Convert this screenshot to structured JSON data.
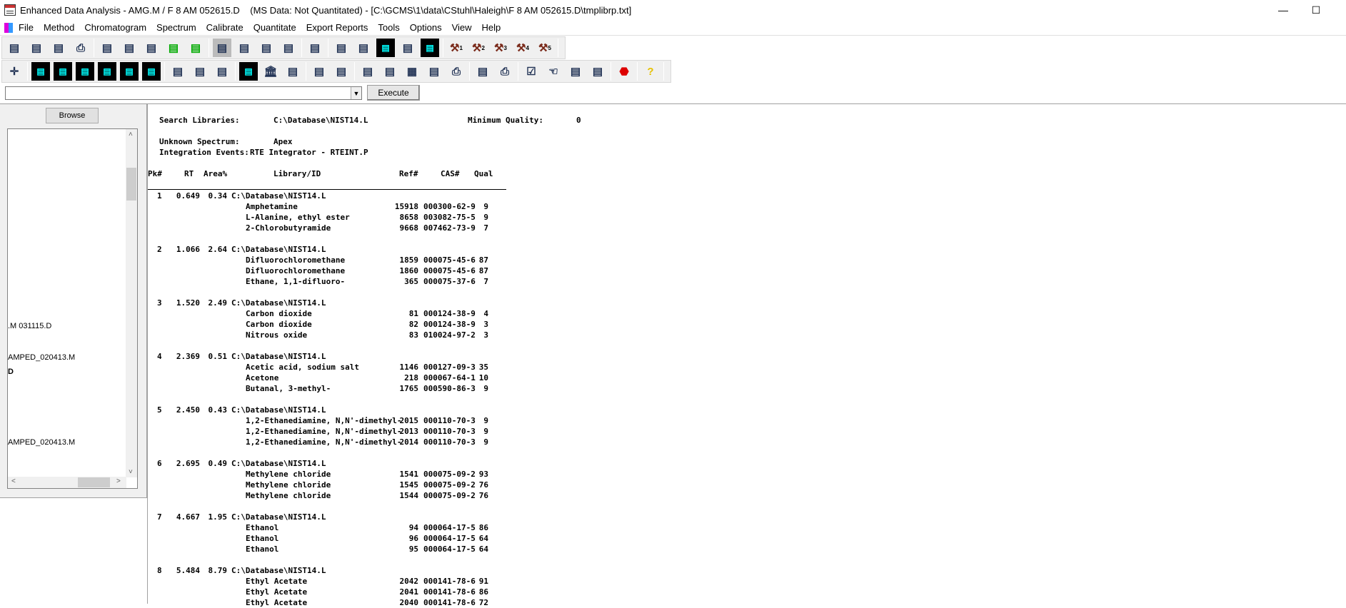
{
  "window": {
    "title": "Enhanced Data Analysis - AMG.M / F 8 AM 052615.D    (MS Data: Not Quantitated) - [C:\\GCMS\\1\\data\\CStuhl\\Haleigh\\F 8 AM 052615.D\\tmplibrp.txt]",
    "minimize": "—",
    "maximize": "☐"
  },
  "menu": [
    "File",
    "Method",
    "Chromatogram",
    "Spectrum",
    "Calibrate",
    "Quantitate",
    "Export Reports",
    "Tools",
    "Options",
    "View",
    "Help"
  ],
  "toolbar1": [
    [
      "open-data-icon",
      "load-data-icon",
      "snapshot-icon",
      "print-icon"
    ],
    [
      "load-method-icon",
      "save-method-icon",
      "run-method-icon",
      "sim-check-icon",
      "sim-edit-icon"
    ],
    [
      "layout-icon",
      "export-layout-icon",
      "color-grid-icon",
      "window-tile-icon"
    ],
    [
      "report-icon"
    ],
    [
      "id-card-icon",
      "edit-id-icon",
      "overlay-peaks-icon",
      "lock-peak-icon",
      "tic-icon"
    ],
    [
      "macro-1-icon",
      "macro-2-icon",
      "macro-3-icon",
      "macro-4-icon",
      "macro-5-icon"
    ]
  ],
  "toolbar1_macro_numbers": [
    "1",
    "2",
    "3",
    "4",
    "5"
  ],
  "toolbar2": [
    [
      "compass-icon"
    ],
    [
      "chromatogram-icon",
      "zoom-chromatogram-icon",
      "mass-spectrum-icon",
      "extract-ion-icon",
      "integrate-down-icon",
      "integrate-check-icon"
    ],
    [
      "peak-check-icon",
      "peak-icon",
      "xy-ratio-icon"
    ],
    [
      "bar-spectrum-icon",
      "library-icon",
      "library-search-icon"
    ],
    [
      "blank-plot-icon",
      "plot-check-icon"
    ],
    [
      "edit-calibration-icon",
      "update-calibration-icon",
      "calculator-icon",
      "quant-report-icon",
      "quant-print-icon"
    ],
    [
      "document-icon",
      "print-document-icon"
    ],
    [
      "ab-checkbox-icon",
      "hand-pointer-icon",
      "xyz-icon",
      "cursor-icon"
    ],
    [
      "stop-icon"
    ],
    [
      "help-icon"
    ]
  ],
  "command": {
    "value": "",
    "execute_label": "Execute"
  },
  "left_panel": {
    "browse_label": "Browse",
    "items": [
      ".M 031115.D",
      "AMPED_020413.M",
      "D",
      "AMPED_020413.M"
    ]
  },
  "report": {
    "search_libraries_label": "Search Libraries:",
    "search_libraries_value": "C:\\Database\\NIST14.L",
    "min_quality_label": "Minimum Quality:",
    "min_quality_value": "0",
    "unknown_spectrum_label": "Unknown Spectrum:",
    "unknown_spectrum_value": "Apex",
    "integration_events_label": "Integration Events:",
    "integration_events_value": "RTE Integrator - RTEINT.P",
    "columns": {
      "pk": "Pk#",
      "rt": "RT",
      "area": "Area%",
      "lib": "Library/ID",
      "ref": "Ref#",
      "cas": "CAS#",
      "qual": "Qual"
    },
    "peaks": [
      {
        "pk": "1",
        "rt": "0.649",
        "area": "0.34",
        "library": "C:\\Database\\NIST14.L",
        "hits": [
          {
            "name": "Amphetamine",
            "ref": "15918",
            "cas": "000300-62-9",
            "qual": "9"
          },
          {
            "name": "L-Alanine, ethyl ester",
            "ref": "8658",
            "cas": "003082-75-5",
            "qual": "9"
          },
          {
            "name": "2-Chlorobutyramide",
            "ref": "9668",
            "cas": "007462-73-9",
            "qual": "7"
          }
        ]
      },
      {
        "pk": "2",
        "rt": "1.066",
        "area": "2.64",
        "library": "C:\\Database\\NIST14.L",
        "hits": [
          {
            "name": "Difluorochloromethane",
            "ref": "1859",
            "cas": "000075-45-6",
            "qual": "87"
          },
          {
            "name": "Difluorochloromethane",
            "ref": "1860",
            "cas": "000075-45-6",
            "qual": "87"
          },
          {
            "name": "Ethane, 1,1-difluoro-",
            "ref": "365",
            "cas": "000075-37-6",
            "qual": "7"
          }
        ]
      },
      {
        "pk": "3",
        "rt": "1.520",
        "area": "2.49",
        "library": "C:\\Database\\NIST14.L",
        "hits": [
          {
            "name": "Carbon dioxide",
            "ref": "81",
            "cas": "000124-38-9",
            "qual": "4"
          },
          {
            "name": "Carbon dioxide",
            "ref": "82",
            "cas": "000124-38-9",
            "qual": "3"
          },
          {
            "name": "Nitrous oxide",
            "ref": "83",
            "cas": "010024-97-2",
            "qual": "3"
          }
        ]
      },
      {
        "pk": "4",
        "rt": "2.369",
        "area": "0.51",
        "library": "C:\\Database\\NIST14.L",
        "hits": [
          {
            "name": "Acetic acid, sodium salt",
            "ref": "1146",
            "cas": "000127-09-3",
            "qual": "35"
          },
          {
            "name": "Acetone",
            "ref": "218",
            "cas": "000067-64-1",
            "qual": "10"
          },
          {
            "name": "Butanal, 3-methyl-",
            "ref": "1765",
            "cas": "000590-86-3",
            "qual": "9"
          }
        ]
      },
      {
        "pk": "5",
        "rt": "2.450",
        "area": "0.43",
        "library": "C:\\Database\\NIST14.L",
        "hits": [
          {
            "name": "1,2-Ethanediamine, N,N'-dimethyl-",
            "ref": "2015",
            "cas": "000110-70-3",
            "qual": "9"
          },
          {
            "name": "1,2-Ethanediamine, N,N'-dimethyl-",
            "ref": "2013",
            "cas": "000110-70-3",
            "qual": "9"
          },
          {
            "name": "1,2-Ethanediamine, N,N'-dimethyl-",
            "ref": "2014",
            "cas": "000110-70-3",
            "qual": "9"
          }
        ]
      },
      {
        "pk": "6",
        "rt": "2.695",
        "area": "0.49",
        "library": "C:\\Database\\NIST14.L",
        "hits": [
          {
            "name": "Methylene chloride",
            "ref": "1541",
            "cas": "000075-09-2",
            "qual": "93"
          },
          {
            "name": "Methylene chloride",
            "ref": "1545",
            "cas": "000075-09-2",
            "qual": "76"
          },
          {
            "name": "Methylene chloride",
            "ref": "1544",
            "cas": "000075-09-2",
            "qual": "76"
          }
        ]
      },
      {
        "pk": "7",
        "rt": "4.667",
        "area": "1.95",
        "library": "C:\\Database\\NIST14.L",
        "hits": [
          {
            "name": "Ethanol",
            "ref": "94",
            "cas": "000064-17-5",
            "qual": "86"
          },
          {
            "name": "Ethanol",
            "ref": "96",
            "cas": "000064-17-5",
            "qual": "64"
          },
          {
            "name": "Ethanol",
            "ref": "95",
            "cas": "000064-17-5",
            "qual": "64"
          }
        ]
      },
      {
        "pk": "8",
        "rt": "5.484",
        "area": "8.79",
        "library": "C:\\Database\\NIST14.L",
        "hits": [
          {
            "name": "Ethyl Acetate",
            "ref": "2042",
            "cas": "000141-78-6",
            "qual": "91"
          },
          {
            "name": "Ethyl Acetate",
            "ref": "2041",
            "cas": "000141-78-6",
            "qual": "86"
          },
          {
            "name": "Ethyl Acetate",
            "ref": "2040",
            "cas": "000141-78-6",
            "qual": "72"
          }
        ]
      }
    ]
  }
}
